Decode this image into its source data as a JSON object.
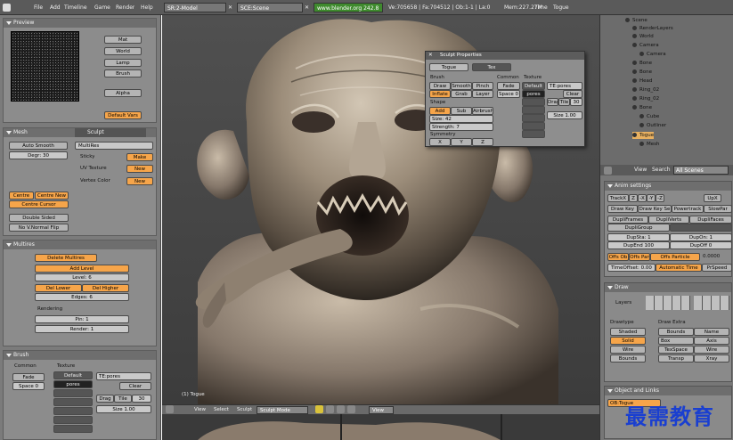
{
  "topbar": {
    "menus": [
      "File",
      "Add",
      "Timeline",
      "Game",
      "Render",
      "Help"
    ],
    "screen": "SR:2-Model",
    "scene": "SCE:Scene",
    "url": "www.blender.org 242.8",
    "stats": "Ve:705658 | Fa:704512 | Ob:1-1 | La:0",
    "mem": "Mem:227.27M",
    "time": "Time",
    "object": "Togue"
  },
  "preview": {
    "title": "Preview",
    "buttons": [
      "Mat",
      "World",
      "Lamp",
      "Brush",
      "Alpha"
    ],
    "default_vars": "Default Vars"
  },
  "mesh": {
    "tabs": [
      "Mesh",
      "Sculpt"
    ],
    "auto_smooth": "Auto Smooth",
    "degr": "Degr: 30",
    "buttons": [
      "Sticky",
      "UV Texture",
      "Vertex Color"
    ],
    "actions": [
      "Make",
      "New",
      "New"
    ],
    "multires_field": "MultiRes",
    "centre": [
      "Centre",
      "Centre New",
      "Centre Cursor"
    ],
    "double_sided": "Double Sided",
    "no_vnormal_flip": "No V.Normal Flip"
  },
  "multires": {
    "title": "Multires",
    "delete": "Delete Multires",
    "add_level": "Add Level",
    "level": "Level: 6",
    "del_lower": "Del Lower",
    "del_higher": "Del Higher",
    "edges": "Edges: 6",
    "rendering": "Rendering",
    "pin": "Pin: 1",
    "render": "Render: 1"
  },
  "brush": {
    "title": "Brush",
    "common": "Common",
    "texture": "Texture",
    "fade": "Fade",
    "space": "Space 0",
    "default": "Default",
    "pores": "pores",
    "te_pores": "TE:pores",
    "clear": "Clear",
    "drag": "Drag",
    "tile": "Tile",
    "tile_val": "30",
    "size": "Size 1.00"
  },
  "sculpt_props": {
    "title": "Sculpt Properties",
    "tabs": [
      "Togue",
      "Tex"
    ],
    "brush_label": "Brush",
    "brush_buttons": [
      "Draw",
      "Smooth",
      "Pinch",
      "Inflate",
      "Grab",
      "Layer"
    ],
    "common_label": "Common",
    "common_buttons": [
      "Fade",
      "Space 0"
    ],
    "texture_label": "Texture",
    "texture_items": [
      "Default",
      "pores"
    ],
    "te_pores": "TE:pores",
    "te_clear": "Clear",
    "drag": "Drag",
    "tile": "Tile",
    "tile_val": "30",
    "size": "Size 1.00",
    "shape_label": "Shape",
    "add": "Add",
    "sub": "Sub",
    "airbrush": "Airbrush",
    "size_field": "Size: 42",
    "strength": "Strength: 7",
    "symmetry": "Symmetry",
    "sym_buttons": [
      "X",
      "Y",
      "Z"
    ]
  },
  "viewport": {
    "status": "(1) Togue"
  },
  "viewport_header": {
    "items": [
      "View",
      "Select",
      "Sculpt"
    ],
    "mode": "Sculpt Mode",
    "view": "View"
  },
  "outliner": {
    "items": [
      "Scene",
      "RenderLayers",
      "World",
      "Camera",
      "Camera",
      "Bone",
      "Bone",
      "Head",
      "Ring_02",
      "Ring_02",
      "Bone",
      "Cube",
      "Outliner",
      "Togue",
      "Mesh"
    ],
    "header_view": "View",
    "header_search": "Search",
    "header_scenes": "All Scenes"
  },
  "anim": {
    "title": "Anim settings",
    "trackx": "TrackX",
    "axes": [
      "Z",
      "-X",
      "-Y",
      "-Z"
    ],
    "upx": "UpX",
    "row2": [
      "Draw Key",
      "Draw Key Se",
      "Powertrack",
      "SlowPar"
    ],
    "row3": [
      "DupliFrames",
      "DupliVerts",
      "DupliFaces"
    ],
    "dupligroup": "DupliGroup",
    "dupsta": "DupSta: 1",
    "dupon": "DupOn: 1",
    "dupend": "DupEnd 100",
    "dupoff": "DupOff 0",
    "offs": [
      "Offs Ob",
      "Offs Par",
      "Offs Particle"
    ],
    "offs_val": "0.0000",
    "timeoffset": "TimeOffset: 0.00",
    "autotime": "Automatic Time",
    "prspeed": "PrSpeed"
  },
  "draw": {
    "title": "Draw",
    "layers": "Layers",
    "drawtype": "Drawtype",
    "drawextra": "Draw Extra",
    "types": [
      "Shaded",
      "Solid",
      "Wire",
      "Bounds"
    ],
    "extra": [
      [
        "Bounds",
        "Name"
      ],
      [
        "Box",
        "Axis"
      ],
      [
        "TexSpace",
        "Wire"
      ],
      [
        "Transp",
        "Xray"
      ]
    ]
  },
  "objlinks": {
    "title": "Object and Links",
    "ob": "OB:Togue"
  },
  "watermark": "最需教育",
  "colors": {
    "orange": "#f6a54a",
    "panel": "#8c8c8c",
    "header": "#5a5a5a",
    "url": "#3f8a2e"
  }
}
